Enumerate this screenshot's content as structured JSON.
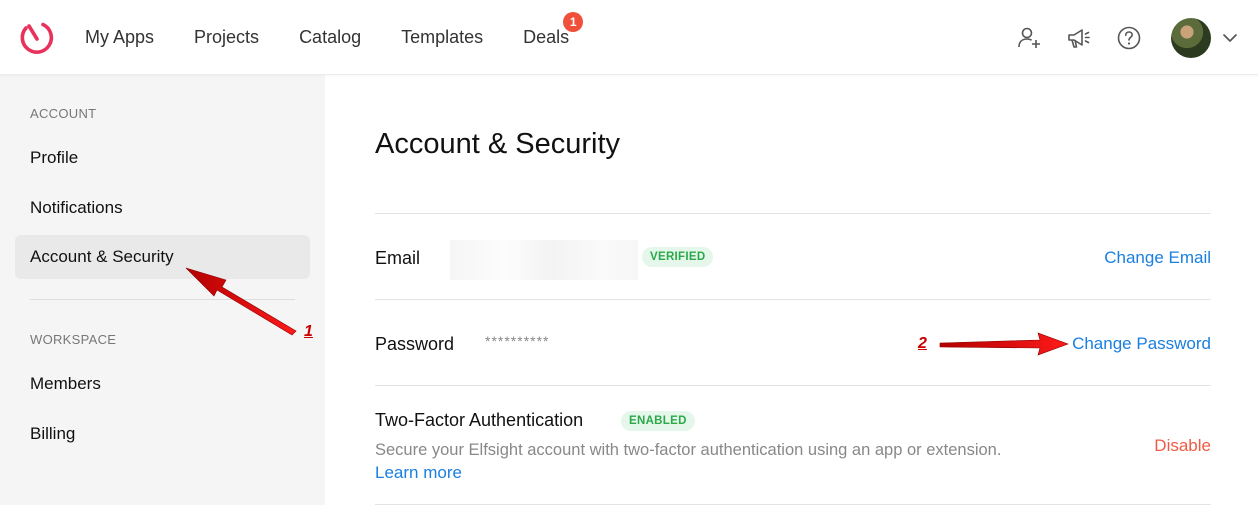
{
  "nav": {
    "items": [
      {
        "label": "My Apps"
      },
      {
        "label": "Projects"
      },
      {
        "label": "Catalog"
      },
      {
        "label": "Templates"
      },
      {
        "label": "Deals"
      }
    ],
    "deals_badge": "1"
  },
  "header_icons": [
    "add-user-icon",
    "megaphone-icon",
    "help-icon",
    "avatar",
    "chevron-down-icon"
  ],
  "sidebar": {
    "account_label": "ACCOUNT",
    "account_items": [
      {
        "label": "Profile"
      },
      {
        "label": "Notifications"
      },
      {
        "label": "Account & Security",
        "active": true
      }
    ],
    "workspace_label": "WORKSPACE",
    "workspace_items": [
      {
        "label": "Members"
      },
      {
        "label": "Billing"
      }
    ]
  },
  "main": {
    "title": "Account & Security",
    "email": {
      "label": "Email",
      "badge": "VERIFIED",
      "action": "Change Email"
    },
    "password": {
      "label": "Password",
      "masked": "**********",
      "action": "Change Password"
    },
    "two_factor": {
      "label": "Two-Factor Authentication",
      "badge": "ENABLED",
      "description": "Secure your Elfsight account with two-factor authentication using an app or extension.",
      "learn_more": "Learn more",
      "action": "Disable"
    }
  },
  "annotations": {
    "marker1": "1",
    "marker2": "2"
  },
  "colors": {
    "brand": "#e8315b",
    "link": "#1a7fe0",
    "danger": "#f05a45",
    "badge_bg": "#e5f7ea",
    "badge_text": "#2ba84a",
    "annotation": "#d00000"
  }
}
